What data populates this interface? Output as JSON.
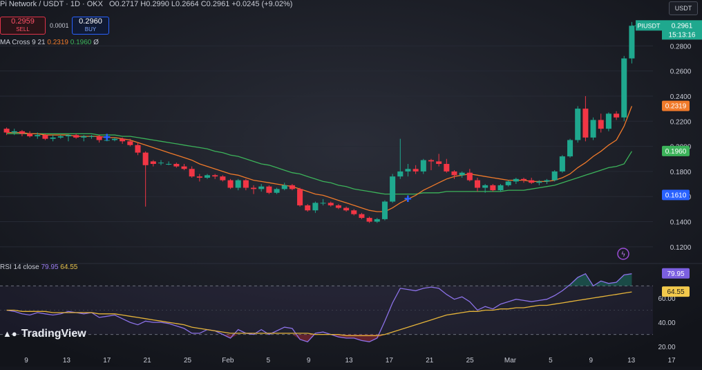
{
  "header": {
    "symbol": "Pi Network / USDT · 1D · OKX",
    "ohlc": "O0.2717 H0.2990 L0.2664 C0.2961 +0.0245 (+9.02%)",
    "currency": "USDT"
  },
  "trade": {
    "sell_price": "0.2959",
    "sell_label": "SELL",
    "spread": "0.0001",
    "buy_price": "0.2960",
    "buy_label": "BUY"
  },
  "indicator": {
    "name": "MA Cross 9 21",
    "v1": "0.2319",
    "v2": "0.1960",
    "suffix": "Ø"
  },
  "rsi_indicator": {
    "name": "RSI 14 close",
    "v1": "79.95",
    "v2": "64.55"
  },
  "branding": {
    "name": "TradingView"
  },
  "colors": {
    "up": "#1fa88e",
    "down": "#f23645",
    "ma_fast": "#f07a2a",
    "ma_slow": "#3cb35a",
    "rsi": "#8c72e8",
    "rsi_ma": "#e6b53a",
    "bg": "#14161d"
  },
  "chart_data": [
    {
      "type": "candlestick",
      "title": "PIUSDT",
      "xlabel": "",
      "ylabel": "",
      "x_ticks": [
        "9",
        "13",
        "17",
        "21",
        "25",
        "Feb",
        "5",
        "9",
        "13",
        "17",
        "21",
        "25",
        "Mar",
        "5",
        "9",
        "13",
        "17"
      ],
      "y_ticks": [
        "0.2800",
        "0.2600",
        "0.2400",
        "0.2200",
        "0.2000",
        "0.1800",
        "0.1600",
        "0.1400",
        "0.1200"
      ],
      "ylim": [
        0.11,
        0.3
      ],
      "price_tag": {
        "symbol": "PIUSDT",
        "price": "0.2961",
        "countdown": "15:13:16"
      },
      "ma_tags": [
        "0.2319",
        "0.1960"
      ],
      "marker_tag": "0.1610",
      "candles": [
        [
          0.214,
          0.215,
          0.209,
          0.211
        ],
        [
          0.211,
          0.214,
          0.209,
          0.212
        ],
        [
          0.212,
          0.213,
          0.208,
          0.21
        ],
        [
          0.21,
          0.212,
          0.207,
          0.208
        ],
        [
          0.208,
          0.211,
          0.206,
          0.209
        ],
        [
          0.209,
          0.21,
          0.205,
          0.206
        ],
        [
          0.206,
          0.209,
          0.204,
          0.207
        ],
        [
          0.207,
          0.209,
          0.206,
          0.208
        ],
        [
          0.208,
          0.209,
          0.204,
          0.209
        ],
        [
          0.209,
          0.21,
          0.206,
          0.207
        ],
        [
          0.207,
          0.209,
          0.204,
          0.208
        ],
        [
          0.208,
          0.209,
          0.206,
          0.208
        ],
        [
          0.208,
          0.209,
          0.203,
          0.205
        ],
        [
          0.205,
          0.206,
          0.204,
          0.205
        ],
        [
          0.205,
          0.207,
          0.204,
          0.206
        ],
        [
          0.206,
          0.207,
          0.202,
          0.204
        ],
        [
          0.204,
          0.206,
          0.2,
          0.201
        ],
        [
          0.201,
          0.203,
          0.193,
          0.195
        ],
        [
          0.195,
          0.196,
          0.152,
          0.185
        ],
        [
          0.188,
          0.189,
          0.184,
          0.186
        ],
        [
          0.187,
          0.189,
          0.185,
          0.187
        ],
        [
          0.186,
          0.188,
          0.185,
          0.186
        ],
        [
          0.186,
          0.187,
          0.183,
          0.184
        ],
        [
          0.184,
          0.186,
          0.181,
          0.182
        ],
        [
          0.182,
          0.184,
          0.175,
          0.176
        ],
        [
          0.176,
          0.178,
          0.172,
          0.175
        ],
        [
          0.175,
          0.178,
          0.174,
          0.177
        ],
        [
          0.177,
          0.178,
          0.174,
          0.176
        ],
        [
          0.176,
          0.177,
          0.172,
          0.173
        ],
        [
          0.173,
          0.174,
          0.166,
          0.167
        ],
        [
          0.167,
          0.174,
          0.165,
          0.173
        ],
        [
          0.173,
          0.174,
          0.165,
          0.167
        ],
        [
          0.167,
          0.169,
          0.162,
          0.166
        ],
        [
          0.166,
          0.17,
          0.164,
          0.168
        ],
        [
          0.168,
          0.169,
          0.162,
          0.163
        ],
        [
          0.163,
          0.167,
          0.162,
          0.166
        ],
        [
          0.166,
          0.171,
          0.165,
          0.169
        ],
        [
          0.169,
          0.17,
          0.165,
          0.166
        ],
        [
          0.166,
          0.167,
          0.152,
          0.153
        ],
        [
          0.153,
          0.154,
          0.148,
          0.149
        ],
        [
          0.149,
          0.156,
          0.147,
          0.155
        ],
        [
          0.155,
          0.158,
          0.153,
          0.155
        ],
        [
          0.155,
          0.156,
          0.152,
          0.153
        ],
        [
          0.153,
          0.154,
          0.15,
          0.151
        ],
        [
          0.151,
          0.152,
          0.148,
          0.149
        ],
        [
          0.149,
          0.15,
          0.145,
          0.146
        ],
        [
          0.146,
          0.147,
          0.142,
          0.143
        ],
        [
          0.143,
          0.144,
          0.139,
          0.14
        ],
        [
          0.14,
          0.143,
          0.139,
          0.142
        ],
        [
          0.142,
          0.157,
          0.141,
          0.156
        ],
        [
          0.156,
          0.178,
          0.155,
          0.176
        ],
        [
          0.176,
          0.206,
          0.174,
          0.18
        ],
        [
          0.18,
          0.186,
          0.176,
          0.182
        ],
        [
          0.182,
          0.185,
          0.178,
          0.18
        ],
        [
          0.18,
          0.19,
          0.178,
          0.189
        ],
        [
          0.189,
          0.19,
          0.181,
          0.188
        ],
        [
          0.188,
          0.194,
          0.184,
          0.186
        ],
        [
          0.186,
          0.19,
          0.179,
          0.18
        ],
        [
          0.18,
          0.181,
          0.174,
          0.177
        ],
        [
          0.177,
          0.18,
          0.175,
          0.179
        ],
        [
          0.179,
          0.182,
          0.172,
          0.173
        ],
        [
          0.173,
          0.175,
          0.164,
          0.167
        ],
        [
          0.167,
          0.17,
          0.163,
          0.169
        ],
        [
          0.169,
          0.17,
          0.164,
          0.165
        ],
        [
          0.165,
          0.17,
          0.164,
          0.169
        ],
        [
          0.169,
          0.173,
          0.168,
          0.172
        ],
        [
          0.172,
          0.175,
          0.17,
          0.174
        ],
        [
          0.174,
          0.175,
          0.171,
          0.173
        ],
        [
          0.173,
          0.175,
          0.17,
          0.171
        ],
        [
          0.171,
          0.173,
          0.169,
          0.172
        ],
        [
          0.172,
          0.174,
          0.17,
          0.173
        ],
        [
          0.173,
          0.181,
          0.172,
          0.18
        ],
        [
          0.18,
          0.193,
          0.179,
          0.192
        ],
        [
          0.192,
          0.206,
          0.191,
          0.205
        ],
        [
          0.205,
          0.232,
          0.203,
          0.23
        ],
        [
          0.23,
          0.24,
          0.204,
          0.207
        ],
        [
          0.207,
          0.223,
          0.205,
          0.221
        ],
        [
          0.221,
          0.226,
          0.211,
          0.214
        ],
        [
          0.214,
          0.227,
          0.212,
          0.226
        ],
        [
          0.226,
          0.228,
          0.221,
          0.223
        ],
        [
          0.223,
          0.272,
          0.22,
          0.27
        ],
        [
          0.27,
          0.299,
          0.266,
          0.296
        ]
      ],
      "ma_fast": [
        0.211,
        0.211,
        0.211,
        0.21,
        0.21,
        0.209,
        0.209,
        0.209,
        0.209,
        0.208,
        0.208,
        0.208,
        0.208,
        0.207,
        0.207,
        0.206,
        0.205,
        0.203,
        0.201,
        0.199,
        0.197,
        0.195,
        0.193,
        0.191,
        0.189,
        0.186,
        0.184,
        0.182,
        0.18,
        0.178,
        0.177,
        0.175,
        0.173,
        0.172,
        0.171,
        0.17,
        0.169,
        0.168,
        0.166,
        0.164,
        0.162,
        0.161,
        0.159,
        0.157,
        0.155,
        0.153,
        0.151,
        0.149,
        0.148,
        0.148,
        0.151,
        0.155,
        0.158,
        0.161,
        0.165,
        0.168,
        0.171,
        0.174,
        0.176,
        0.177,
        0.178,
        0.177,
        0.176,
        0.175,
        0.174,
        0.173,
        0.173,
        0.173,
        0.172,
        0.172,
        0.172,
        0.173,
        0.175,
        0.178,
        0.183,
        0.187,
        0.192,
        0.196,
        0.201,
        0.205,
        0.216,
        0.232
      ],
      "ma_slow": [
        0.21,
        0.21,
        0.21,
        0.21,
        0.21,
        0.21,
        0.21,
        0.21,
        0.21,
        0.21,
        0.21,
        0.21,
        0.209,
        0.209,
        0.209,
        0.208,
        0.208,
        0.207,
        0.206,
        0.205,
        0.204,
        0.203,
        0.202,
        0.201,
        0.2,
        0.199,
        0.198,
        0.196,
        0.195,
        0.193,
        0.192,
        0.19,
        0.188,
        0.186,
        0.185,
        0.183,
        0.181,
        0.179,
        0.178,
        0.176,
        0.174,
        0.172,
        0.171,
        0.169,
        0.168,
        0.166,
        0.165,
        0.164,
        0.163,
        0.162,
        0.162,
        0.162,
        0.162,
        0.162,
        0.163,
        0.163,
        0.163,
        0.164,
        0.164,
        0.164,
        0.164,
        0.164,
        0.164,
        0.164,
        0.164,
        0.165,
        0.165,
        0.165,
        0.166,
        0.167,
        0.168,
        0.169,
        0.171,
        0.173,
        0.175,
        0.177,
        0.179,
        0.181,
        0.183,
        0.184,
        0.186,
        0.196
      ],
      "cross_markers": [
        13,
        52
      ]
    },
    {
      "type": "line",
      "title": "RSI 14 close",
      "xlabel": "",
      "ylabel": "",
      "y_ticks": [
        "60.00",
        "40.00",
        "20.00"
      ],
      "ylim": [
        15,
        85
      ],
      "bands": [
        70,
        30
      ],
      "series": [
        {
          "name": "RSI",
          "values": [
            50,
            49,
            47,
            46,
            48,
            47,
            46,
            47,
            49,
            48,
            47,
            48,
            44,
            45,
            46,
            43,
            40,
            38,
            41,
            40,
            40,
            39,
            37,
            35,
            31,
            31,
            34,
            33,
            30,
            27,
            34,
            31,
            30,
            34,
            30,
            33,
            36,
            35,
            26,
            24,
            31,
            32,
            30,
            28,
            27,
            27,
            25,
            24,
            27,
            41,
            56,
            68,
            67,
            66,
            68,
            69,
            68,
            63,
            59,
            61,
            57,
            50,
            53,
            51,
            55,
            57,
            59,
            58,
            57,
            58,
            59,
            62,
            66,
            71,
            77,
            80,
            70,
            74,
            72,
            73,
            79,
            80
          ]
        },
        {
          "name": "RSI MA",
          "values": [
            50,
            50,
            49,
            49,
            49,
            49,
            48,
            48,
            48,
            48,
            48,
            48,
            47,
            47,
            47,
            46,
            45,
            44,
            43,
            42,
            41,
            40,
            39,
            38,
            36,
            35,
            34,
            33,
            32,
            31,
            31,
            31,
            31,
            31,
            31,
            31,
            31,
            31,
            31,
            31,
            30,
            30,
            30,
            30,
            29,
            29,
            29,
            29,
            29,
            30,
            32,
            34,
            36,
            38,
            40,
            42,
            44,
            46,
            47,
            48,
            49,
            49,
            50,
            50,
            51,
            51,
            52,
            52,
            53,
            54,
            54,
            55,
            56,
            57,
            58,
            59,
            60,
            61,
            62,
            63,
            64,
            65
          ]
        }
      ]
    }
  ]
}
